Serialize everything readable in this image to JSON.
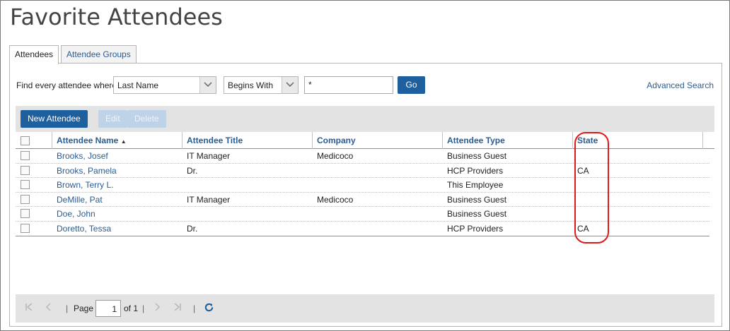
{
  "page": {
    "title": "Favorite Attendees"
  },
  "tabs": [
    {
      "label": "Attendees",
      "active": true
    },
    {
      "label": "Attendee Groups",
      "active": false
    }
  ],
  "search": {
    "label": "Find every attendee where",
    "field_selected": "Last Name",
    "operator_selected": "Begins With",
    "value": "*",
    "go_label": "Go",
    "advanced_label": "Advanced Search"
  },
  "toolbar": {
    "new_label": "New Attendee",
    "edit_label": "Edit",
    "delete_label": "Delete"
  },
  "table": {
    "columns": [
      "Attendee Name",
      "Attendee Title",
      "Company",
      "Attendee Type",
      "State"
    ],
    "sort_indicator": "▲",
    "rows": [
      {
        "name": "Brooks, Josef",
        "title": "IT Manager",
        "company": "Medicoco",
        "type": "Business Guest",
        "state": ""
      },
      {
        "name": "Brooks, Pamela",
        "title": "Dr.",
        "company": "",
        "type": "HCP Providers",
        "state": "CA"
      },
      {
        "name": "Brown, Terry L.",
        "title": "",
        "company": "",
        "type": "This Employee",
        "state": ""
      },
      {
        "name": "DeMille, Pat",
        "title": "IT Manager",
        "company": "Medicoco",
        "type": "Business Guest",
        "state": ""
      },
      {
        "name": "Doe, John",
        "title": "",
        "company": "",
        "type": "Business Guest",
        "state": ""
      },
      {
        "name": "Doretto, Tessa",
        "title": "Dr.",
        "company": "",
        "type": "HCP Providers",
        "state": "CA"
      }
    ]
  },
  "pager": {
    "page_label": "Page",
    "page_value": "1",
    "of_label": "of 1",
    "separator": "|"
  },
  "colors": {
    "accent": "#1e5f9e",
    "link": "#2a5c93",
    "highlight_circle": "#e01818"
  }
}
